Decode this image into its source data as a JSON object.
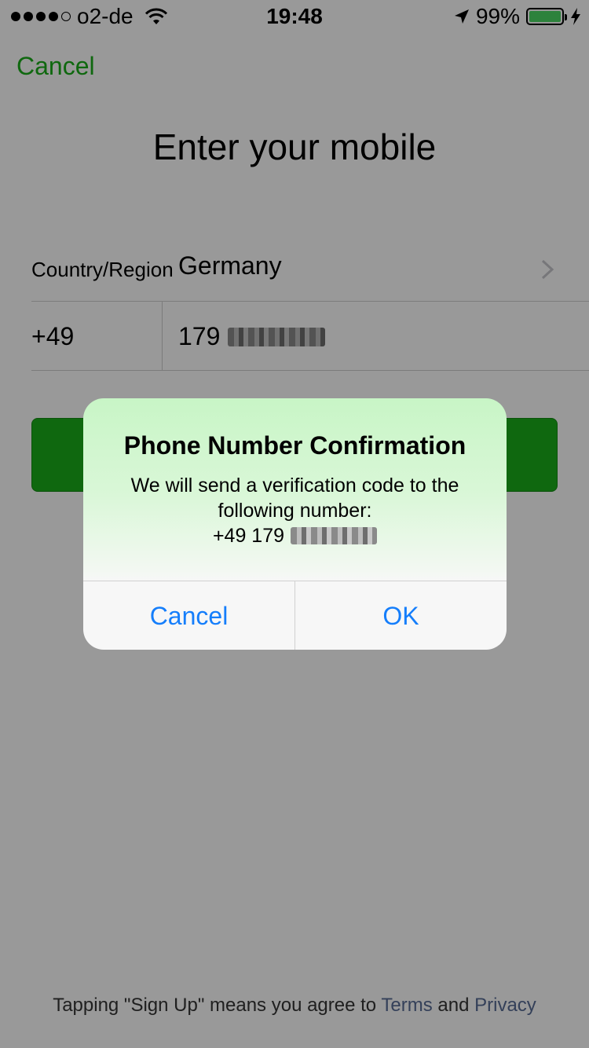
{
  "status_bar": {
    "carrier": "o2-de",
    "time": "19:48",
    "battery_percent": "99%",
    "battery_level": 0.99,
    "signal_bars": 4,
    "signal_total": 5
  },
  "nav": {
    "cancel_label": "Cancel"
  },
  "page": {
    "title": "Enter your mobile"
  },
  "form": {
    "country_label": "Country/Region",
    "country_value": "Germany",
    "country_code": "+49",
    "phone_prefix": "179"
  },
  "dialog": {
    "title": "Phone Number Confirmation",
    "message": "We will send a verification code to the following number:",
    "number_prefix": "+49 179",
    "cancel_label": "Cancel",
    "ok_label": "OK"
  },
  "footer": {
    "text_before": "Tapping \"Sign Up\" means you agree to ",
    "terms_link": "Terms",
    "and_word": " and ",
    "privacy_link": "Privacy"
  },
  "colors": {
    "accent_green": "#1aad19",
    "ios_blue": "#157efb",
    "link_blue": "#576b95"
  }
}
